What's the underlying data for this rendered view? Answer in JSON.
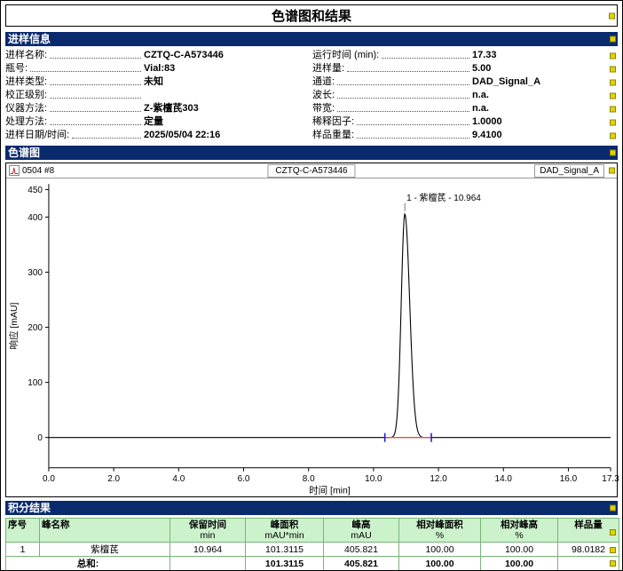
{
  "page": {
    "title": "色谱图和结果"
  },
  "colors": {
    "section_header_bg": "#0a2a6e",
    "section_header_text": "#ffffff",
    "table_header_bg": "#ccf2cc",
    "table_border": "#79b479",
    "selection_handle": "#e3d400",
    "trace": "#000000",
    "integration_baseline": "#e05050",
    "integration_marker": "#2222cc"
  },
  "injection_info": {
    "header": "进样信息",
    "left_rows": [
      {
        "label": "进样名称:",
        "value": "CZTQ-C-A573446"
      },
      {
        "label": "瓶号:",
        "value": "Vial:83"
      },
      {
        "label": "进样类型:",
        "value": "未知"
      },
      {
        "label": "校正级别:",
        "value": ""
      },
      {
        "label": "仪器方法:",
        "value": "Z-紫檀芪303"
      },
      {
        "label": "处理方法:",
        "value": "定量"
      },
      {
        "label": "进样日期/时间:",
        "value": "2025/05/04 22:16"
      }
    ],
    "right_rows": [
      {
        "label": "运行时间 (min):",
        "value": "17.33"
      },
      {
        "label": "进样量:",
        "value": "5.00"
      },
      {
        "label": "通道:",
        "value": "DAD_Signal_A"
      },
      {
        "label": "波长:",
        "value": "n.a."
      },
      {
        "label": "带宽:",
        "value": "n.a."
      },
      {
        "label": "稀释因子:",
        "value": "1.0000"
      },
      {
        "label": "样品重量:",
        "value": "9.4100"
      }
    ]
  },
  "chromatogram": {
    "header": "色谱图",
    "strip": {
      "icon": "chromatogram-icon",
      "left": "0504 #8",
      "center": "CZTQ-C-A573446",
      "right": "DAD_Signal_A"
    }
  },
  "integration": {
    "header": "积分结果",
    "table": {
      "columns": [
        {
          "name": "序号",
          "unit": ""
        },
        {
          "name": "峰名称",
          "unit": ""
        },
        {
          "name": "保留时间",
          "unit": "min"
        },
        {
          "name": "峰面积",
          "unit": "mAU*min"
        },
        {
          "name": "峰高",
          "unit": "mAU"
        },
        {
          "name": "相对峰面积",
          "unit": "%"
        },
        {
          "name": "相对峰高",
          "unit": "%"
        },
        {
          "name": "样品量",
          "unit": ""
        }
      ],
      "rows": [
        [
          "1",
          "紫檀芪",
          "10.964",
          "101.3115",
          "405.821",
          "100.00",
          "100.00",
          "98.0182"
        ]
      ],
      "total_label": "总和:",
      "total_row": [
        "",
        "101.3115",
        "405.821",
        "100.00",
        "100.00",
        ""
      ]
    }
  },
  "chart_data": {
    "type": "line",
    "title": "CZTQ-C-A573446",
    "signal": "DAD_Signal_A",
    "xlabel": "时间 [min]",
    "ylabel": "响应 [mAU]",
    "xlim": [
      0,
      17.3
    ],
    "ylim": [
      -55,
      460
    ],
    "x_ticks": [
      0,
      2,
      4,
      6,
      8,
      10,
      12,
      14,
      16,
      17.3
    ],
    "x_tick_labels": [
      "0.0",
      "2.0",
      "4.0",
      "6.0",
      "8.0",
      "10.0",
      "12.0",
      "14.0",
      "16.0",
      "17.3"
    ],
    "y_ticks": [
      0,
      100,
      200,
      300,
      400,
      450
    ],
    "y_tick_labels": [
      "0",
      "100",
      "200",
      "300",
      "400",
      "450"
    ],
    "grid": false,
    "baseline_mAU": 0,
    "series": [
      {
        "name": "DAD_Signal_A",
        "peaks": [
          {
            "index": 1,
            "name": "紫檀芪",
            "label": "1 - 紫檀芪 - 10.964",
            "retention_min": 10.964,
            "height_mAU": 405.821,
            "area_mAU_min": 101.3115,
            "sigma_left_min": 0.11,
            "sigma_right_min": 0.15
          }
        ]
      }
    ],
    "integration_baseline": {
      "start_min": 10.35,
      "end_min": 11.78,
      "y_mAU": 0
    }
  }
}
